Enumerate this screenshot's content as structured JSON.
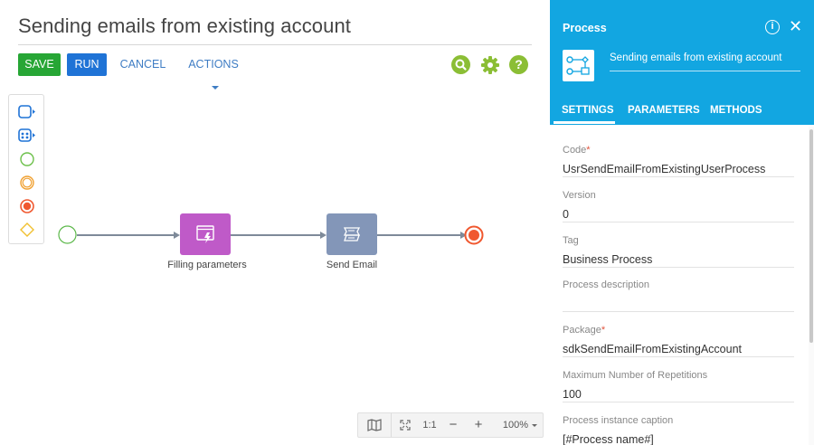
{
  "process_title": "Sending emails from existing account",
  "toolbar": {
    "save_label": "SAVE",
    "run_label": "RUN",
    "cancel_label": "CANCEL",
    "actions_label": "ACTIONS",
    "icons": [
      "search-icon",
      "gear-icon",
      "help-icon"
    ]
  },
  "palette": {
    "items": [
      "user-task-icon",
      "script-task-icon",
      "start-event-icon",
      "intermediate-event-icon",
      "end-event-icon",
      "gateway-icon"
    ]
  },
  "diagram": {
    "nodes": [
      {
        "label": "Filling parameters",
        "type": "user-task",
        "color": "#bf5ac8"
      },
      {
        "label": "Send Email",
        "type": "send-email",
        "color": "#8396b8"
      }
    ],
    "colors": {
      "start_event": "#5cb84a",
      "end_event": "#f0582f",
      "connector": "#7e8a99"
    }
  },
  "zoom": {
    "fit_label": "1:1",
    "minus_label": "−",
    "plus_label": "+",
    "level": "100%"
  },
  "panel": {
    "title": "Process",
    "process_name": "Sending emails from existing account",
    "tabs": [
      {
        "label": "SETTINGS",
        "active": true
      },
      {
        "label": "PARAMETERS",
        "active": false
      },
      {
        "label": "METHODS",
        "active": false
      }
    ],
    "fields": [
      {
        "label": "Code",
        "required": true,
        "value": "UsrSendEmailFromExistingUserProcess"
      },
      {
        "label": "Version",
        "required": false,
        "value": "0"
      },
      {
        "label": "Tag",
        "required": false,
        "value": "Business Process"
      },
      {
        "label": "Process description",
        "required": false,
        "value": ""
      },
      {
        "label": "Package",
        "required": true,
        "value": "sdkSendEmailFromExistingAccount"
      },
      {
        "label": "Maximum Number of Repetitions",
        "required": false,
        "value": "100"
      },
      {
        "label": "Process instance caption",
        "required": false,
        "value": "[#Process name#]"
      }
    ],
    "accent_color": "#12a6e1"
  }
}
